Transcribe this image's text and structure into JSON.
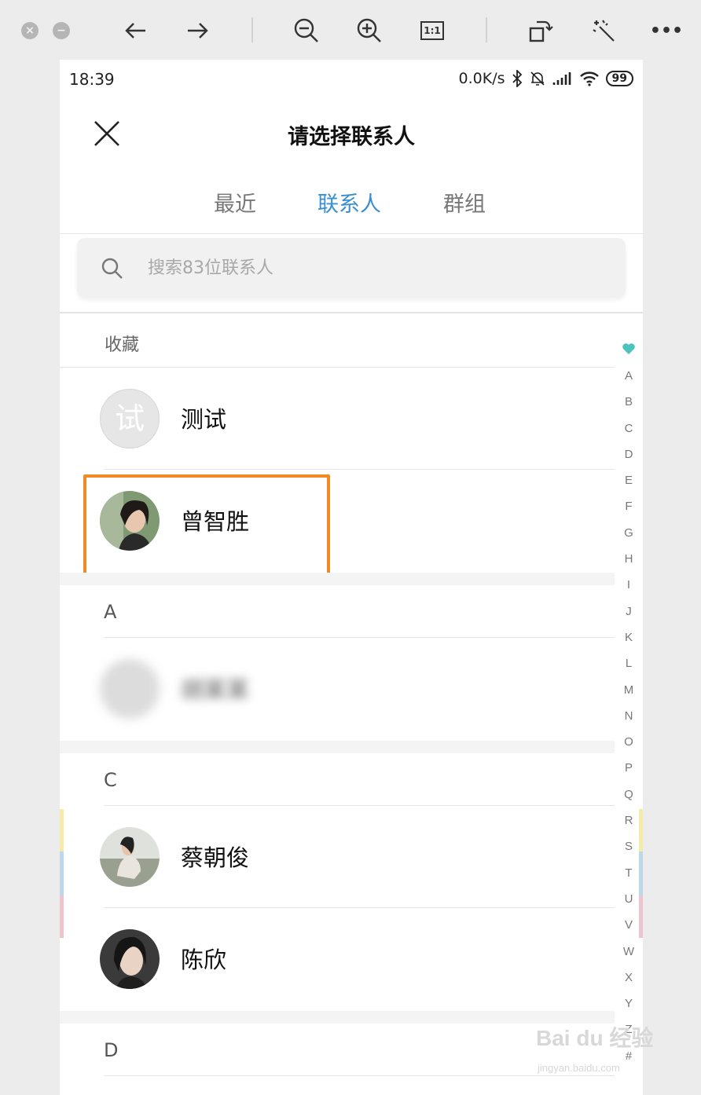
{
  "viewer": {
    "toolbar_icons": [
      "close-icon",
      "minimize-icon",
      "back-arrow-icon",
      "forward-arrow-icon",
      "zoom-out-icon",
      "zoom-in-icon",
      "actual-size-icon",
      "rotate-icon",
      "magic-wand-icon",
      "more-icon"
    ],
    "actual_size_label": "1:1",
    "more_label": "•••"
  },
  "status_bar": {
    "time": "18:39",
    "speed": "0.0K/s",
    "battery": "99"
  },
  "header": {
    "title": "请选择联系人"
  },
  "tabs": [
    {
      "label": "最近",
      "active": false
    },
    {
      "label": "联系人",
      "active": true
    },
    {
      "label": "群组",
      "active": false
    }
  ],
  "search": {
    "placeholder": "搜索83位联系人"
  },
  "sections": {
    "favorites": "收藏",
    "a": "A",
    "c": "C",
    "d": "D"
  },
  "contacts": {
    "fav1": {
      "name": "测试",
      "avatar_text": "试"
    },
    "fav2": {
      "name": "曾智胜"
    },
    "a1": {
      "name": "胡某某"
    },
    "c1": {
      "name": "蔡朝俊"
    },
    "c2": {
      "name": "陈欣"
    }
  },
  "index_bar": [
    "A",
    "B",
    "C",
    "D",
    "E",
    "F",
    "G",
    "H",
    "I",
    "J",
    "K",
    "L",
    "M",
    "N",
    "O",
    "P",
    "Q",
    "R",
    "S",
    "T",
    "U",
    "V",
    "W",
    "X",
    "Y",
    "Z",
    "#"
  ],
  "watermark": {
    "main": "Bai du 经验",
    "sub": "jingyan.baidu.com"
  },
  "colors": {
    "accent": "#3a8fd0",
    "highlight": "#f08a24",
    "favorite": "#4dc3bf"
  }
}
